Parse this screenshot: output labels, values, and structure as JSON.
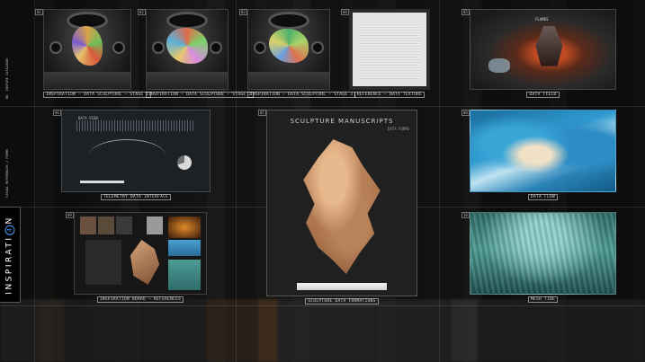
{
  "side_label": {
    "text_before": "INSPIRATI",
    "number": "4",
    "text_after": "N"
  },
  "side_notes": {
    "top": "NO. INSPIRE   CATALOGUE",
    "mid": "VISUAL   REFERENCES   /   FORMS"
  },
  "tiles": [
    {
      "tag": "01",
      "caption": "INSPIRATION — DATA SCULPTURE — STAGE 1"
    },
    {
      "tag": "02",
      "caption": "INSPIRATION — DATA SCULPTURE — STAGE 2"
    },
    {
      "tag": "03",
      "caption": "INSPIRATION — DATA SCULPTURE — STAGE 3"
    },
    {
      "tag": "04",
      "caption": "REFERENCE — DATA TEXTURE"
    },
    {
      "tag": "05",
      "caption": "DATA FIELD",
      "inner_label": "FLAMES"
    },
    {
      "tag": "06",
      "caption": "TELEMETRY DATA INTERFACE",
      "panel_title": "DATA VIEW"
    },
    {
      "tag": "07",
      "caption": "SCULPTURE DATA FORMATIONS",
      "poster_title": "SCULPTURE MANUSCRIPTS",
      "poster_sub": "DATA FORMS"
    },
    {
      "tag": "08",
      "caption": "DATA FLOW"
    },
    {
      "tag": "09",
      "caption": "INSPIRATION BOARD — REFERENCES"
    },
    {
      "tag": "10",
      "caption": "MESH TIDE"
    }
  ],
  "colors": {
    "accent": "#4aa3ff",
    "background": "#141414"
  }
}
